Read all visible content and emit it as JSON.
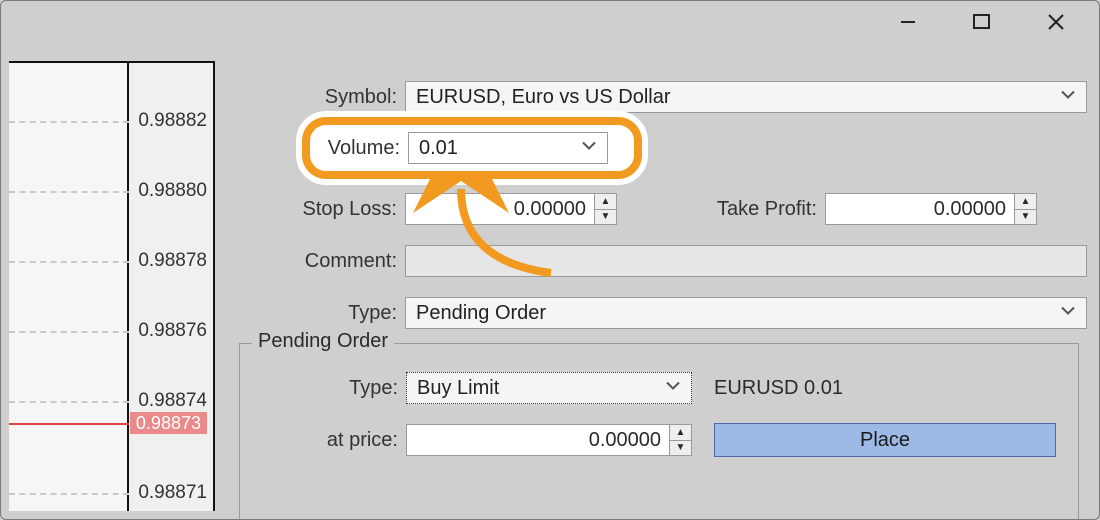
{
  "chart": {
    "ticks": [
      "0.98882",
      "0.98880",
      "0.98878",
      "0.98876",
      "0.98874",
      "0.98871"
    ],
    "current": "0.98873"
  },
  "labels": {
    "symbol": "Symbol:",
    "volume": "Volume:",
    "stoploss": "Stop Loss:",
    "takeprofit": "Take Profit:",
    "comment": "Comment:",
    "type": "Type:",
    "pending_group": "Pending Order",
    "pending_type": "Type:",
    "pending_atprice": "at price:"
  },
  "values": {
    "symbol": "EURUSD, Euro vs US Dollar",
    "volume": "0.01",
    "stoploss": "0.00000",
    "takeprofit": "0.00000",
    "comment": "",
    "type": "Pending Order",
    "pending_type": "Buy Limit",
    "pending_summary": "EURUSD 0.01",
    "atprice": "0.00000",
    "place_btn": "Place"
  }
}
